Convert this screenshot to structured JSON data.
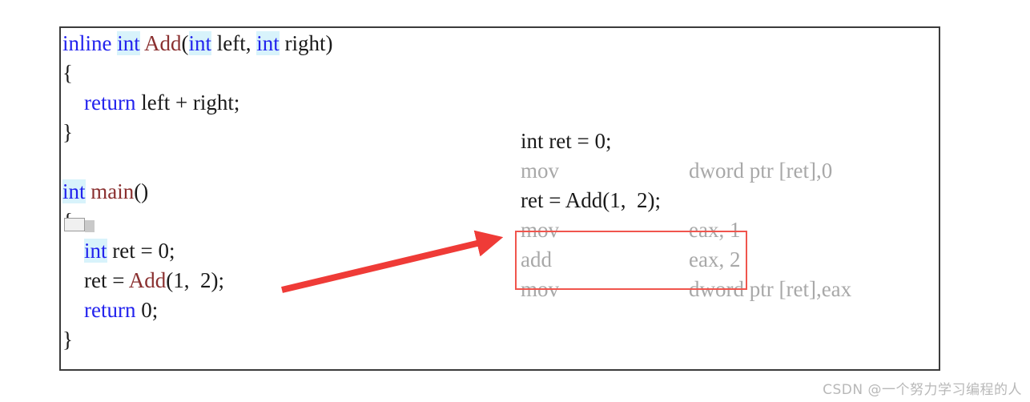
{
  "source_code": {
    "lines": [
      [
        {
          "t": "inline",
          "c": "kw"
        },
        {
          "t": " ",
          "c": "plain"
        },
        {
          "t": "int",
          "c": "kw-hl"
        },
        {
          "t": " ",
          "c": "plain"
        },
        {
          "t": "Add",
          "c": "fn"
        },
        {
          "t": "(",
          "c": "punct"
        },
        {
          "t": "int",
          "c": "kw-hl"
        },
        {
          "t": " left, ",
          "c": "plain"
        },
        {
          "t": "int",
          "c": "kw-hl"
        },
        {
          "t": " right)",
          "c": "plain"
        }
      ],
      [
        {
          "t": "{",
          "c": "punct"
        }
      ],
      [
        {
          "t": "    ",
          "c": "plain"
        },
        {
          "t": "return",
          "c": "kw"
        },
        {
          "t": " left + right;",
          "c": "plain"
        }
      ],
      [
        {
          "t": "}",
          "c": "punct"
        }
      ],
      [],
      [
        {
          "t": "int",
          "c": "kw-hl"
        },
        {
          "t": " ",
          "c": "plain"
        },
        {
          "t": "main",
          "c": "fn"
        },
        {
          "t": "()",
          "c": "punct"
        }
      ],
      [
        {
          "t": "{",
          "c": "punct"
        }
      ],
      [
        {
          "t": "    ",
          "c": "plain"
        },
        {
          "t": "int",
          "c": "kw-hl"
        },
        {
          "t": " ret = ",
          "c": "plain"
        },
        {
          "t": "0",
          "c": "num"
        },
        {
          "t": ";",
          "c": "plain"
        }
      ],
      [
        {
          "t": "    ret = ",
          "c": "plain"
        },
        {
          "t": "Add",
          "c": "fn"
        },
        {
          "t": "(",
          "c": "punct"
        },
        {
          "t": "1",
          "c": "num"
        },
        {
          "t": ",  ",
          "c": "plain"
        },
        {
          "t": "2",
          "c": "num"
        },
        {
          "t": ");",
          "c": "punct"
        }
      ],
      [
        {
          "t": "    ",
          "c": "plain"
        },
        {
          "t": "return",
          "c": "kw"
        },
        {
          "t": " ",
          "c": "plain"
        },
        {
          "t": "0",
          "c": "num"
        },
        {
          "t": ";",
          "c": "plain"
        }
      ],
      [
        {
          "t": "}",
          "c": "punct"
        }
      ]
    ]
  },
  "disassembly": {
    "rows": [
      {
        "kind": "source",
        "text": "int ret = 0;"
      },
      {
        "kind": "asm",
        "mnemonic": "mov",
        "operands": "dword ptr [ret],0"
      },
      {
        "kind": "source",
        "text": "ret = Add(1,  2);"
      },
      {
        "kind": "asm",
        "mnemonic": "mov",
        "operands": "eax, 1"
      },
      {
        "kind": "asm",
        "mnemonic": "add",
        "operands": "eax, 2"
      },
      {
        "kind": "asm",
        "mnemonic": "mov",
        "operands": "dword ptr [ret],eax"
      }
    ]
  },
  "annotations": {
    "highlight_box_color": "#f0554d",
    "arrow_color": "#ef3b37",
    "keyword_color": "#2222ee",
    "function_color": "#8a3030",
    "keyword_highlight_bg": "#d8f3fb",
    "asm_text_color": "#a8a8a8"
  },
  "watermark": {
    "text": "CSDN @一个努力学习编程的人"
  }
}
